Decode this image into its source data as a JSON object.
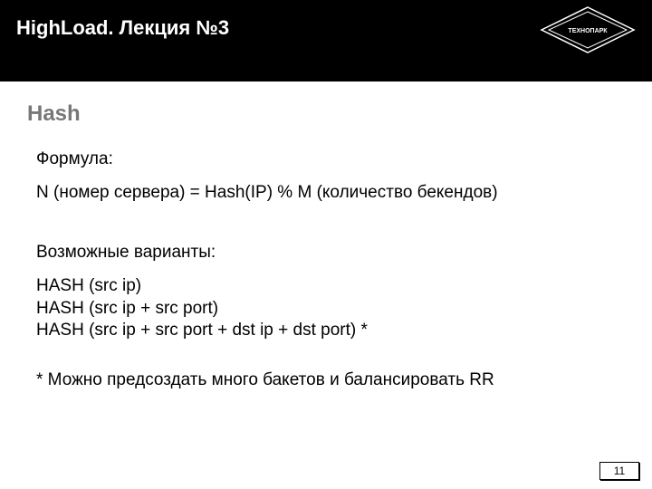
{
  "header": {
    "title": "HighLoad. Лекция №3",
    "logo_text": "ТЕХНОПАРК"
  },
  "section_title": "Hash",
  "formula_label": "Формула:",
  "formula": "N (номер сервера) = Hash(IP) % M (количество бекендов)",
  "variants_label": "Возможные варианты:",
  "variants": [
    "HASH (src ip)",
    "HASH (src ip + src port)",
    "HASH (src ip + src port + dst ip + dst port) *"
  ],
  "footnote": "* Можно предсоздать много бакетов и балансировать RR",
  "page_number": "11"
}
